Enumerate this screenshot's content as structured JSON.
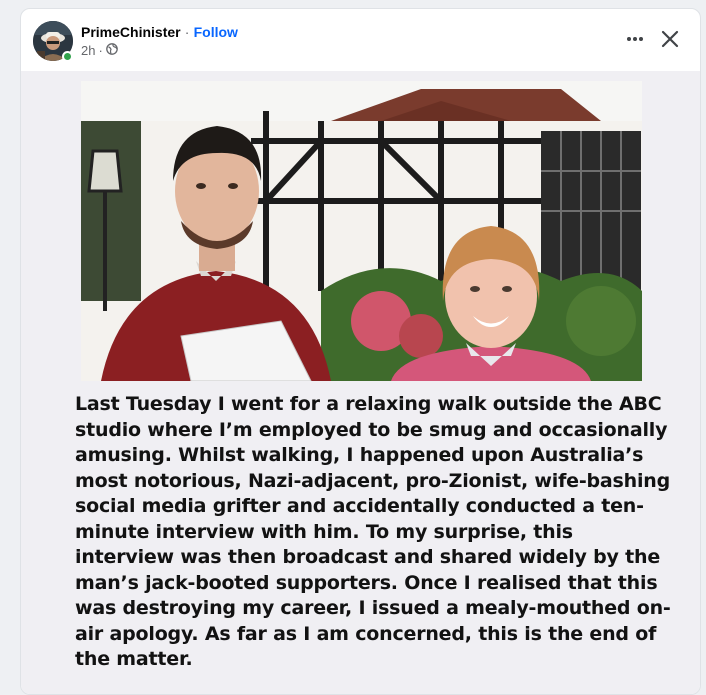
{
  "post": {
    "author": "PrimeChinister",
    "separator": "·",
    "follow_label": "Follow",
    "timestamp": "2h",
    "audience_icon": "globe-icon",
    "more_icon": "more-options-icon",
    "close_icon": "close-icon"
  },
  "image": {
    "description_icon": "meme-photo",
    "caption_lines": [
      "Last Tuesday I went for a relaxing walk outside the ABC",
      "studio where I’m employed to be smug and occasionally",
      "amusing. Whilst walking, I happened upon Australia’s",
      "most notorious, Nazi-adjacent, pro-Zionist, wife-bashing",
      "social media grifter and accidentally conducted a ten-",
      "minute interview with him. To my surprise, this",
      "interview was then broadcast and shared widely by the",
      "man’s jack-booted supporters. Once I realised that this",
      "was destroying my career, I issued a mealy-mouthed on-",
      "air apology. As far as I am concerned, this is the end of",
      "the matter."
    ]
  },
  "colors": {
    "follow": "#0866ff",
    "online": "#31a24c",
    "secondary_text": "#65676b"
  }
}
